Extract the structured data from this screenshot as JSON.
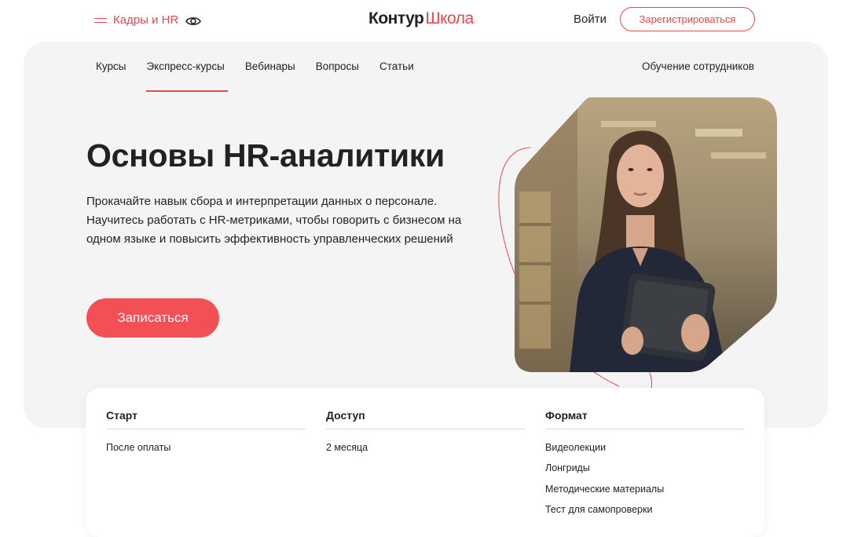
{
  "header": {
    "menu_label": "Кадры и HR",
    "logo_part1": "Контур",
    "logo_part2": "Школа",
    "login_label": "Войти",
    "register_label": "Зарегистрироваться"
  },
  "nav": {
    "items": [
      {
        "label": "Курсы"
      },
      {
        "label": "Экспресс-курсы"
      },
      {
        "label": "Вебинары"
      },
      {
        "label": "Вопросы"
      },
      {
        "label": "Статьи"
      }
    ],
    "active_index": 1,
    "right_label": "Обучение сотрудников"
  },
  "hero": {
    "title": "Основы HR-аналитики",
    "description": "Прокачайте навык сбора и интерпретации данных о персонале. Научитесь работать с HR-метриками, чтобы говорить с бизнесом на одном языке и повысить эффективность управленческих решений",
    "cta_label": "Записаться"
  },
  "info": {
    "columns": [
      {
        "title": "Старт",
        "items": [
          "После оплаты"
        ]
      },
      {
        "title": "Доступ",
        "items": [
          "2 месяца"
        ]
      },
      {
        "title": "Формат",
        "items": [
          "Видеолекции",
          "Лонгриды",
          "Методические материалы",
          "Тест для самопроверки"
        ]
      }
    ]
  },
  "colors": {
    "accent": "#e5484d",
    "cta": "#f25055",
    "panel": "#f4f4f4",
    "text": "#222222"
  },
  "icons": {
    "menu": "hamburger-icon",
    "accessibility": "eye-icon"
  }
}
